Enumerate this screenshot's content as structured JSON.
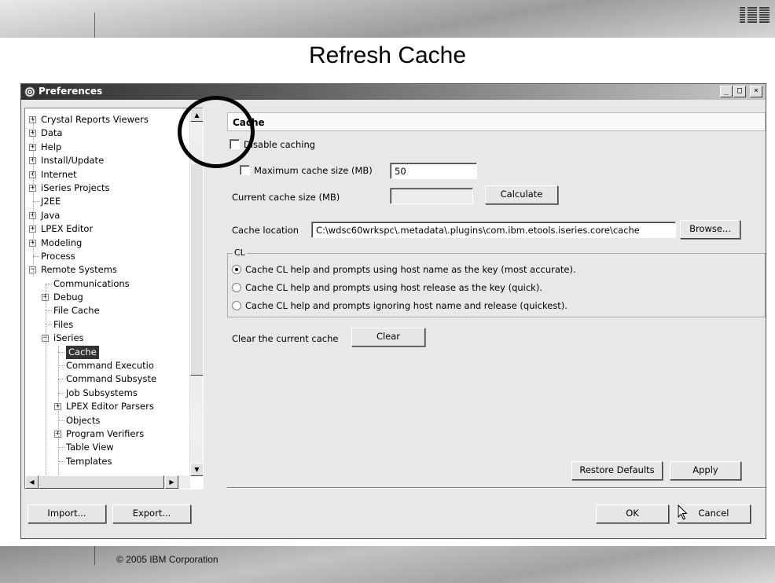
{
  "slide": {
    "title": "Refresh Cache",
    "copyright": "© 2005 IBM Corporation",
    "logo_text": "IBM"
  },
  "window": {
    "title": "Preferences",
    "controls": {
      "minimize": "_",
      "maximize": "□",
      "close": "×"
    }
  },
  "tree": {
    "items": [
      {
        "label": "Crystal Reports Viewers",
        "expander": "+",
        "level": 0
      },
      {
        "label": "Data",
        "expander": "+",
        "level": 0
      },
      {
        "label": "Help",
        "expander": "+",
        "level": 0
      },
      {
        "label": "Install/Update",
        "expander": "+",
        "level": 0
      },
      {
        "label": "Internet",
        "expander": "+",
        "level": 0
      },
      {
        "label": "iSeries Projects",
        "expander": "+",
        "level": 0
      },
      {
        "label": "J2EE",
        "expander": "",
        "level": 0
      },
      {
        "label": "Java",
        "expander": "+",
        "level": 0
      },
      {
        "label": "LPEX Editor",
        "expander": "+",
        "level": 0
      },
      {
        "label": "Modeling",
        "expander": "+",
        "level": 0
      },
      {
        "label": "Process",
        "expander": "",
        "level": 0
      },
      {
        "label": "Remote Systems",
        "expander": "−",
        "level": 0
      },
      {
        "label": "Communications",
        "expander": "",
        "level": 1
      },
      {
        "label": "Debug",
        "expander": "+",
        "level": 1
      },
      {
        "label": "File Cache",
        "expander": "",
        "level": 1
      },
      {
        "label": "Files",
        "expander": "",
        "level": 1
      },
      {
        "label": "iSeries",
        "expander": "−",
        "level": 1
      },
      {
        "label": "Cache",
        "expander": "",
        "level": 2,
        "selected": true
      },
      {
        "label": "Command Executio",
        "expander": "",
        "level": 2
      },
      {
        "label": "Command Subsyste",
        "expander": "",
        "level": 2
      },
      {
        "label": "Job Subsystems",
        "expander": "",
        "level": 2
      },
      {
        "label": "LPEX Editor Parsers",
        "expander": "+",
        "level": 2
      },
      {
        "label": "Objects",
        "expander": "",
        "level": 2
      },
      {
        "label": "Program Verifiers",
        "expander": "+",
        "level": 2
      },
      {
        "label": "Table View",
        "expander": "",
        "level": 2
      },
      {
        "label": "Templates",
        "expander": "",
        "level": 2
      }
    ],
    "scroll_up": "▲",
    "scroll_down": "▼",
    "scroll_left": "◀",
    "scroll_right": "▶"
  },
  "pane": {
    "header": "Cache",
    "disable_caching_label": "Disable caching",
    "disable_caching_checked": false,
    "max_cache_label": "Maximum cache size (MB)",
    "max_cache_checked": false,
    "max_cache_value": "50",
    "current_cache_label": "Current cache size (MB)",
    "current_cache_value": "",
    "calculate_button": "Calculate",
    "cache_location_label": "Cache location",
    "cache_location_value": "C:\\wdsc60wrkspc\\.metadata\\.plugins\\com.ibm.etools.iseries.core\\cache",
    "browse_button": "Browse...",
    "cl_group_label": "CL",
    "cl_options": [
      {
        "label": "Cache CL help and prompts using host name as the key (most accurate).",
        "selected": true
      },
      {
        "label": "Cache CL help and prompts using host release as the key (quick).",
        "selected": false
      },
      {
        "label": "Cache CL help and prompts ignoring host name and release (quickest).",
        "selected": false
      }
    ],
    "clear_label": "Clear the current cache",
    "clear_button": "Clear",
    "restore_defaults_button": "Restore Defaults",
    "apply_button": "Apply"
  },
  "footer": {
    "import_button": "Import...",
    "export_button": "Export...",
    "ok_button": "OK",
    "cancel_button": "Cancel"
  }
}
